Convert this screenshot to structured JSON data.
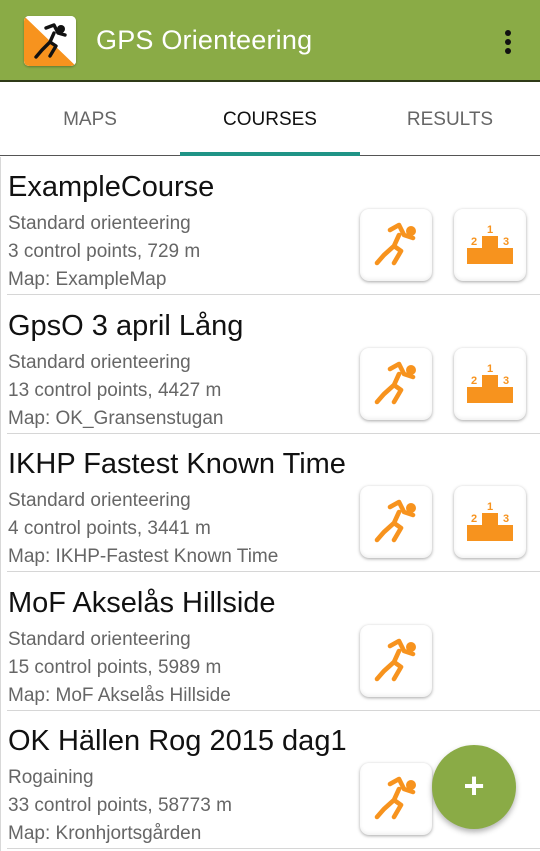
{
  "appbar": {
    "title": "GPS Orienteering",
    "logo_icon": "orienteering-runner-logo",
    "overflow_icon": "more-vert-icon",
    "color": "#8aab46"
  },
  "tabs": [
    {
      "label": "MAPS",
      "active": false
    },
    {
      "label": "COURSES",
      "active": true
    },
    {
      "label": "RESULTS",
      "active": false
    }
  ],
  "tab_indicator_color": "#1f9486",
  "courses": [
    {
      "title": "ExampleCourse",
      "type": "Standard orienteering",
      "details": "3 control points, 729 m",
      "map": "Map: ExampleMap",
      "has_results": true
    },
    {
      "title": "GpsO 3 april Lång",
      "type": "Standard orienteering",
      "details": "13 control points, 4427 m",
      "map": "Map: OK_Gransenstugan",
      "has_results": true
    },
    {
      "title": "IKHP Fastest Known Time",
      "type": "Standard orienteering",
      "details": "4 control points, 3441 m",
      "map": "Map: IKHP-Fastest Known Time",
      "has_results": true
    },
    {
      "title": "MoF Akselås Hillside",
      "type": "Standard orienteering",
      "details": "15 control points, 5989 m",
      "map": "Map: MoF Akselås Hillside",
      "has_results": false
    },
    {
      "title": "OK Hällen Rog 2015 dag1",
      "type": "Rogaining",
      "details": "33 control points, 58773 m",
      "map": "Map: Kronhjortsgården",
      "has_results": false
    }
  ],
  "icons": {
    "run": "runner-icon",
    "results": "podium-icon",
    "podium_labels": [
      "1",
      "2",
      "3"
    ]
  },
  "accent_orange": "#f7931e",
  "fab": {
    "label": "+",
    "icon": "add-icon"
  }
}
